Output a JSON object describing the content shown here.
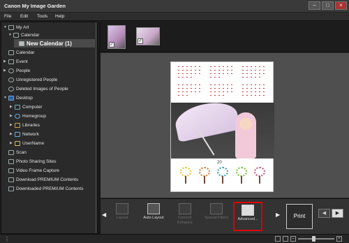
{
  "window": {
    "title": "Canon My Image Garden",
    "minimize": "–",
    "maximize": "□",
    "close": "×"
  },
  "menu": [
    "File",
    "Edit",
    "Tools",
    "Help"
  ],
  "sidebar": {
    "items": [
      {
        "label": "My Art",
        "arrow": "▼"
      },
      {
        "label": "Calendar",
        "arrow": "▼"
      },
      {
        "label": "New Calendar (1)",
        "arrow": ""
      },
      {
        "label": "Calendar",
        "arrow": ""
      },
      {
        "label": "Event",
        "arrow": "▶"
      },
      {
        "label": "People",
        "arrow": "▶"
      },
      {
        "label": "Unregistered People",
        "arrow": ""
      },
      {
        "label": "Deleted Images of People",
        "arrow": ""
      },
      {
        "label": "Desktop",
        "arrow": "▼"
      },
      {
        "label": "Computer",
        "arrow": "▶"
      },
      {
        "label": "Homegroup",
        "arrow": "▶"
      },
      {
        "label": "Libraries",
        "arrow": "▶"
      },
      {
        "label": "Network",
        "arrow": "▶"
      },
      {
        "label": "UserName",
        "arrow": "▶"
      },
      {
        "label": "Scan",
        "arrow": ""
      },
      {
        "label": "Photo Sharing Sites",
        "arrow": ""
      },
      {
        "label": "Video Frame Capture",
        "arrow": ""
      },
      {
        "label": "Download PREMIUM Contents",
        "arrow": ""
      },
      {
        "label": "Downloaded PREMIUM Contents",
        "arrow": ""
      }
    ]
  },
  "thumbnails": {
    "check": "✓"
  },
  "canvas": {
    "year": "20"
  },
  "toolbar": {
    "prev": "◀",
    "next": "▶",
    "tools": [
      {
        "label": "Layout",
        "enabled": false
      },
      {
        "label": "Auto Layout",
        "enabled": true
      },
      {
        "label": "Correct/ Enhance",
        "enabled": false
      },
      {
        "label": "Special Filters",
        "enabled": false
      },
      {
        "label": "Advanced...",
        "enabled": true,
        "highlighted": true
      }
    ],
    "print_label": "Print",
    "page_prev": "◀",
    "page_next": "▶"
  },
  "statusbar": {
    "menu_dots": "⋮",
    "zoom_minus": "–",
    "zoom_plus": "+"
  },
  "colors": {
    "highlight": "#e00000"
  }
}
